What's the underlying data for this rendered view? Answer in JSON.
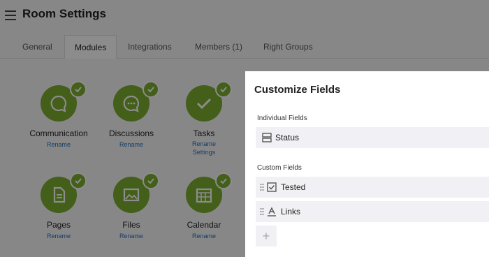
{
  "header": {
    "title": "Room Settings"
  },
  "tabs": [
    {
      "label": "General"
    },
    {
      "label": "Modules"
    },
    {
      "label": "Integrations"
    },
    {
      "label": "Members (1)"
    },
    {
      "label": "Right Groups"
    }
  ],
  "modules": [
    {
      "name": "Communication",
      "links": [
        "Rename"
      ]
    },
    {
      "name": "Discussions",
      "links": [
        "Rename"
      ]
    },
    {
      "name": "Tasks",
      "links": [
        "Rename",
        "Settings"
      ]
    },
    {
      "name": "Pages",
      "links": [
        "Rename"
      ]
    },
    {
      "name": "Files",
      "links": [
        "Rename"
      ]
    },
    {
      "name": "Calendar",
      "links": [
        "Rename"
      ]
    }
  ],
  "panel": {
    "title": "Customize Fields",
    "individual_label": "Individual Fields",
    "individual_fields": [
      {
        "label": "Status"
      }
    ],
    "custom_label": "Custom Fields",
    "custom_fields": [
      {
        "label": "Tested"
      },
      {
        "label": "Links"
      }
    ],
    "add_label": "+"
  },
  "colors": {
    "module_green": "#7aad2f",
    "link_blue": "#2a6ebb"
  }
}
